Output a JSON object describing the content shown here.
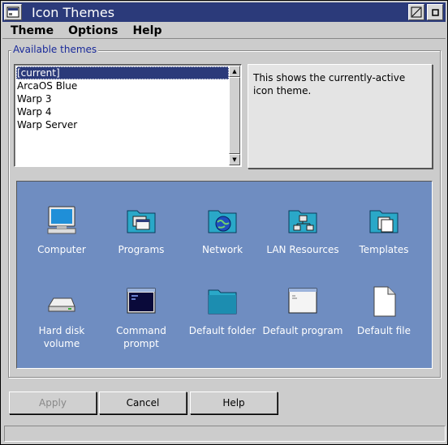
{
  "window": {
    "title": "Icon Themes"
  },
  "menu": [
    {
      "label": "Theme"
    },
    {
      "label": "Options"
    },
    {
      "label": "Help"
    }
  ],
  "group": {
    "label": "Available themes"
  },
  "themes": {
    "items": [
      "[current]",
      "ArcaOS Blue",
      "Warp 3",
      "Warp 4",
      "Warp Server"
    ],
    "selected_index": 0
  },
  "description": "This shows the currently-active icon theme.",
  "preview": {
    "icons": [
      {
        "label": "Computer",
        "icon": "computer-icon"
      },
      {
        "label": "Programs",
        "icon": "programs-folder-icon"
      },
      {
        "label": "Network",
        "icon": "network-folder-icon"
      },
      {
        "label": "LAN Resources",
        "icon": "lan-resources-folder-icon"
      },
      {
        "label": "Templates",
        "icon": "templates-folder-icon"
      },
      {
        "label": "Hard disk volume",
        "icon": "hard-disk-icon"
      },
      {
        "label": "Command prompt",
        "icon": "command-prompt-icon"
      },
      {
        "label": "Default folder",
        "icon": "folder-icon"
      },
      {
        "label": "Default program",
        "icon": "program-window-icon"
      },
      {
        "label": "Default file",
        "icon": "file-icon"
      }
    ]
  },
  "buttons": {
    "apply": "Apply",
    "cancel": "Cancel",
    "help": "Help"
  },
  "colors": {
    "titlebar": "#2b3a7a",
    "preview_background": "#6f8dc1",
    "group_label": "#1a2a9a"
  }
}
